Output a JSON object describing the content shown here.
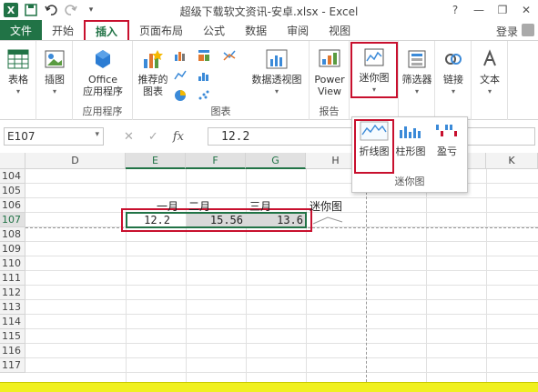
{
  "window": {
    "title": "超级下载软文资讯-安卓.xlsx - Excel",
    "app_icon_letter": "X",
    "controls": [
      "?",
      "—",
      "❐",
      "✕"
    ]
  },
  "quick_access": [
    "save-icon",
    "undo-icon",
    "redo-icon",
    "customize-icon"
  ],
  "tabs": [
    {
      "label": "文件",
      "type": "file"
    },
    {
      "label": "开始"
    },
    {
      "label": "插入",
      "active": true
    },
    {
      "label": "页面布局"
    },
    {
      "label": "公式"
    },
    {
      "label": "数据"
    },
    {
      "label": "审阅"
    },
    {
      "label": "视图"
    }
  ],
  "login_label": "登录",
  "ribbon": {
    "groups": {
      "table": {
        "label": ""
      },
      "apps": {
        "label": "应用程序"
      },
      "charts": {
        "label": "图表"
      },
      "reports": {
        "label": "报告"
      }
    },
    "buttons": {
      "table": "表格",
      "illustrations": "插图",
      "office_apps_1": "Office",
      "office_apps_2": "应用程序",
      "recommended_1": "推荐的",
      "recommended_2": "图表",
      "pivotchart": "数据透视图",
      "power_view_1": "Power",
      "power_view_2": "View",
      "sparklines": "迷你图",
      "filters": "筛选器",
      "links": "链接",
      "text": "文本"
    }
  },
  "formula_bar": {
    "name_box": "E107",
    "formula": "12.2"
  },
  "sparkline_dropdown": {
    "items": [
      {
        "label": "折线图",
        "icon": "sparkline-line-icon"
      },
      {
        "label": "柱形图",
        "icon": "sparkline-column-icon"
      },
      {
        "label": "盈亏",
        "icon": "sparkline-winloss-icon"
      }
    ],
    "group_label": "迷你图"
  },
  "grid": {
    "columns": [
      "D",
      "E",
      "F",
      "G",
      "H",
      "I",
      "J",
      "K"
    ],
    "selected_columns": [
      "E",
      "F",
      "G"
    ],
    "rows": [
      "104",
      "105",
      "106",
      "107",
      "108",
      "109",
      "110",
      "111",
      "112",
      "113",
      "114",
      "115",
      "116",
      "117"
    ],
    "selected_row": "107",
    "headers_row106": [
      "一月",
      "二月",
      "三月",
      "迷你图"
    ],
    "values_row107": [
      "12.2",
      "15.56",
      "13.6"
    ]
  }
}
